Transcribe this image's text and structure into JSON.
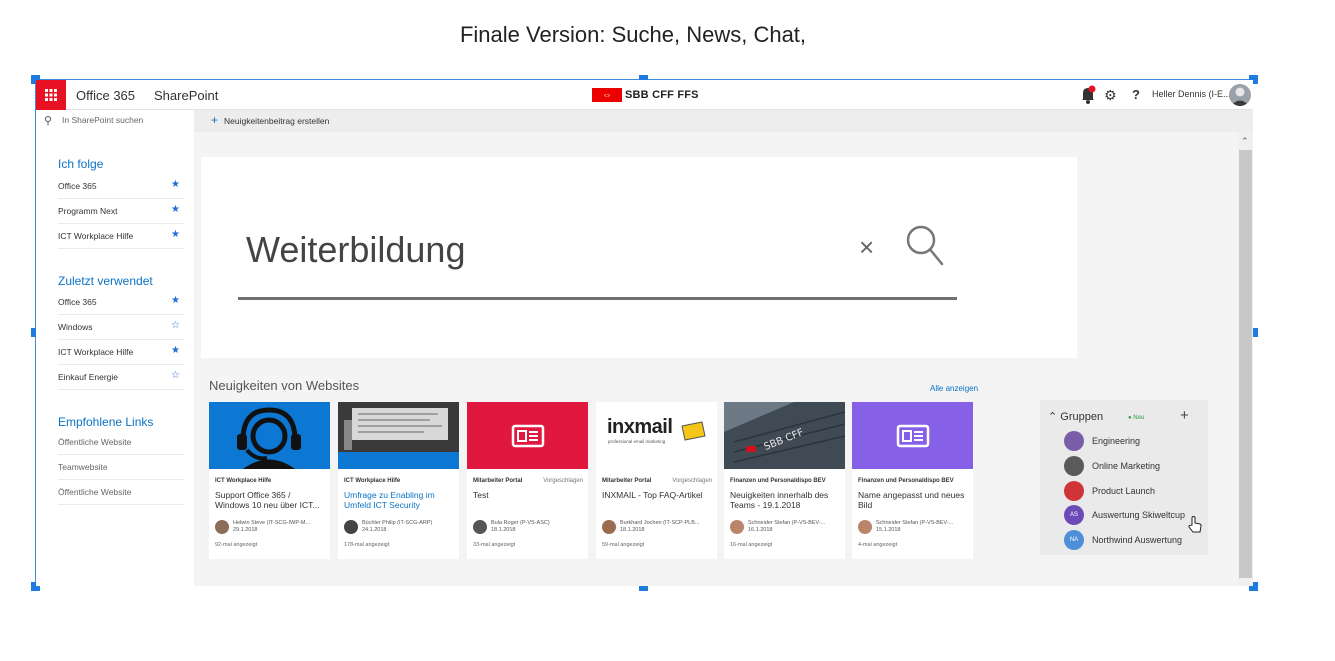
{
  "slide_title": "Finale Version: Suche, News, Chat,",
  "suitebar": {
    "app": "Office 365",
    "product": "SharePoint",
    "logo_text": "SBB CFF FFS",
    "help": "?",
    "user_name": "Heller Dennis (I-E...",
    "icons": [
      "waffle-icon",
      "bell-icon",
      "gear-icon",
      "help-icon",
      "user-avatar"
    ]
  },
  "leftnav": {
    "search_placeholder": "In SharePoint suchen",
    "following": {
      "title": "Ich folge",
      "items": [
        {
          "label": "Office 365",
          "star": "★"
        },
        {
          "label": "Programm Next",
          "star": "★"
        },
        {
          "label": "ICT Workplace Hilfe",
          "star": "★"
        }
      ]
    },
    "recent": {
      "title": "Zuletzt verwendet",
      "items": [
        {
          "label": "Office 365",
          "star": "★"
        },
        {
          "label": "Windows",
          "star": "☆"
        },
        {
          "label": "ICT Workplace Hilfe",
          "star": "★"
        },
        {
          "label": "Einkauf Energie",
          "star": "☆"
        }
      ]
    },
    "links": {
      "title": "Empfohlene Links",
      "items": [
        {
          "label": "Öffentliche Website"
        },
        {
          "label": "Teamwebsite"
        },
        {
          "label": "Öffentliche Website"
        }
      ]
    }
  },
  "cmdbar": {
    "new_post": "Neuigkeitenbeitrag erstellen"
  },
  "search": {
    "query": "Weiterbildung"
  },
  "news": {
    "title": "Neuigkeiten von Websites",
    "see_all": "Alle anzeigen",
    "cards": [
      {
        "site": "ICT Workplace Hilfe",
        "tag": "",
        "title": "Support Office 365 / Windows 10 neu über ICT...",
        "author": "Helwin Steve (IT-SCG-IWP-M...",
        "date": "29.1.2018",
        "views": "92-mal angezeigt"
      },
      {
        "site": "ICT Workplace Hilfe",
        "tag": "",
        "title": "Umfrage zu Enabling im Umfeld ICT Security",
        "author": "Büchler Philip (IT-SCG-ARP)",
        "date": "24.1.2018",
        "views": "178-mal angezeigt"
      },
      {
        "site": "Mitarbeiter Portal",
        "tag": "Vorgeschlagen",
        "title": "Test",
        "author": "Bula Roger (P-VS-ASC)",
        "date": "18.1.2018",
        "views": "33-mal angezeigt"
      },
      {
        "site": "Mitarbeiter Portal",
        "tag": "Vorgeschlagen",
        "title": "INXMAIL - Top FAQ-Artikel",
        "author": "Burkhard Jochen (IT-SCP-PLB...",
        "date": "18.1.2018",
        "views": "59-mal angezeigt"
      },
      {
        "site": "Finanzen und Personaldispo BEV",
        "tag": "",
        "title": "Neuigkeiten innerhalb des Teams - 19.1.2018",
        "author": "Schneider Stefan (P-VS-BEV-...",
        "date": "16.1.2018",
        "views": "16-mal angezeigt"
      },
      {
        "site": "Finanzen und Personaldispo BEV",
        "tag": "",
        "title": "Name angepasst und neues Bild",
        "author": "Schneider Stefan (P-VS-BEV-...",
        "date": "15.1.2018",
        "views": "4-mal angezeigt"
      }
    ],
    "inxmail": {
      "brand": "inxmail",
      "sub": "professional email marketing"
    }
  },
  "groups": {
    "title": "Gruppen",
    "badge": "● Neu",
    "add": "+",
    "items": [
      {
        "label": "Engineering",
        "initials": "",
        "color": "#7a5da8"
      },
      {
        "label": "Online Marketing",
        "initials": "",
        "color": "#5a5a5a"
      },
      {
        "label": "Product Launch",
        "initials": "",
        "color": "#d13438"
      },
      {
        "label": "Auswertung Skiweltcup",
        "initials": "AS",
        "color": "#6b4bb8"
      },
      {
        "label": "Northwind Auswertung",
        "initials": "NA",
        "color": "#4f8fd8"
      }
    ]
  }
}
